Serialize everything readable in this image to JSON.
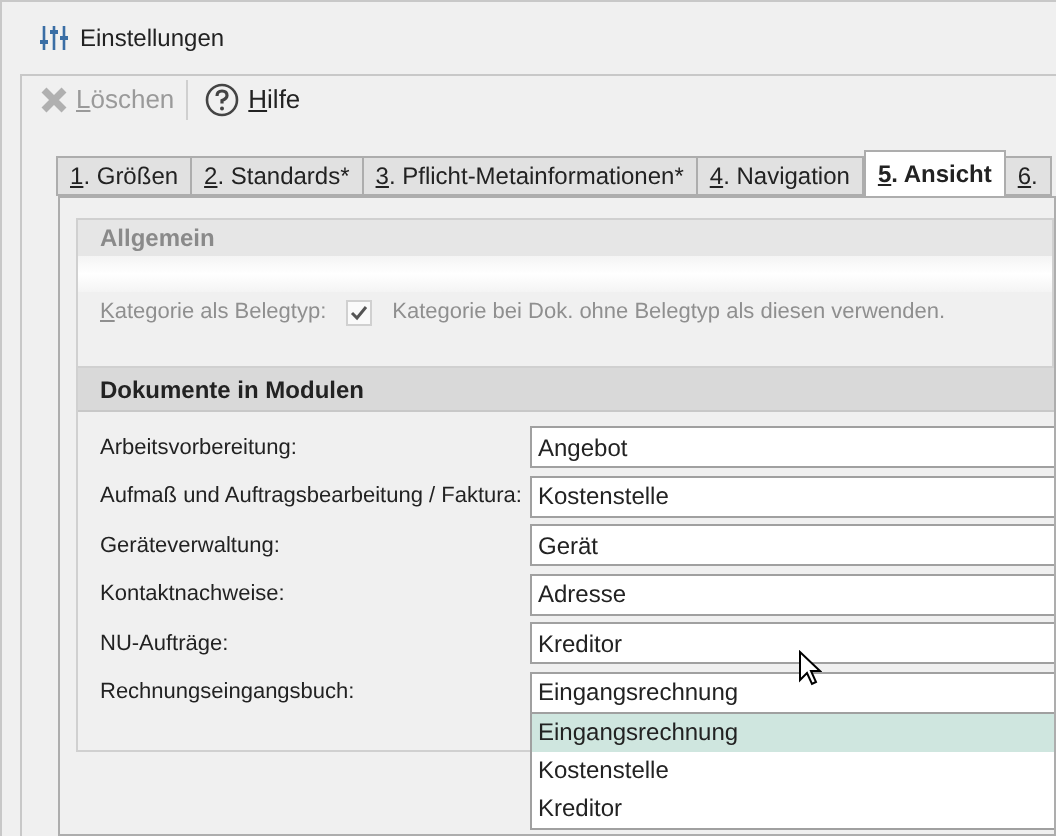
{
  "window": {
    "title": "Einstellungen"
  },
  "toolbar": [
    {
      "kind": "delete",
      "label": "Löschen",
      "disabled": true
    },
    {
      "kind": "help",
      "label": "Hilfe",
      "disabled": false
    }
  ],
  "tabs": [
    {
      "label": "1. Größen",
      "selected": false
    },
    {
      "label": "2. Standards*",
      "selected": false
    },
    {
      "label": "3. Pflicht-Metainformationen*",
      "selected": false
    },
    {
      "label": "4. Navigation",
      "selected": false
    },
    {
      "label": "5. Ansicht",
      "selected": true
    },
    {
      "label": "6.",
      "selected": false
    }
  ],
  "general": {
    "title": "Allgemein",
    "label": "Kategorie als Belegtyp:",
    "checkbox": {
      "label": "Kategorie bei Dok. ohne Belegtyp als diesen verwenden.",
      "checked": true
    }
  },
  "modules": {
    "title": "Dokumente in Modulen",
    "rows": [
      {
        "label": "Arbeitsvorbereitung:",
        "value": "Angebot"
      },
      {
        "label": "Aufmaß und Auftragsbearbeitung / Faktura:",
        "value": "Kostenstelle"
      },
      {
        "label": "Geräteverwaltung:",
        "value": "Gerät"
      },
      {
        "label": "Kontaktnachweise:",
        "value": "Adresse"
      },
      {
        "label": "NU-Aufträge:",
        "value": "Kreditor"
      },
      {
        "label": "Rechnungseingangsbuch:",
        "value": "Eingangsrechnung"
      }
    ]
  },
  "dropdown": [
    {
      "label": "Eingangsrechnung",
      "selected": true
    },
    {
      "label": "Kostenstelle",
      "selected": false
    },
    {
      "label": "Kreditor",
      "selected": false
    }
  ]
}
